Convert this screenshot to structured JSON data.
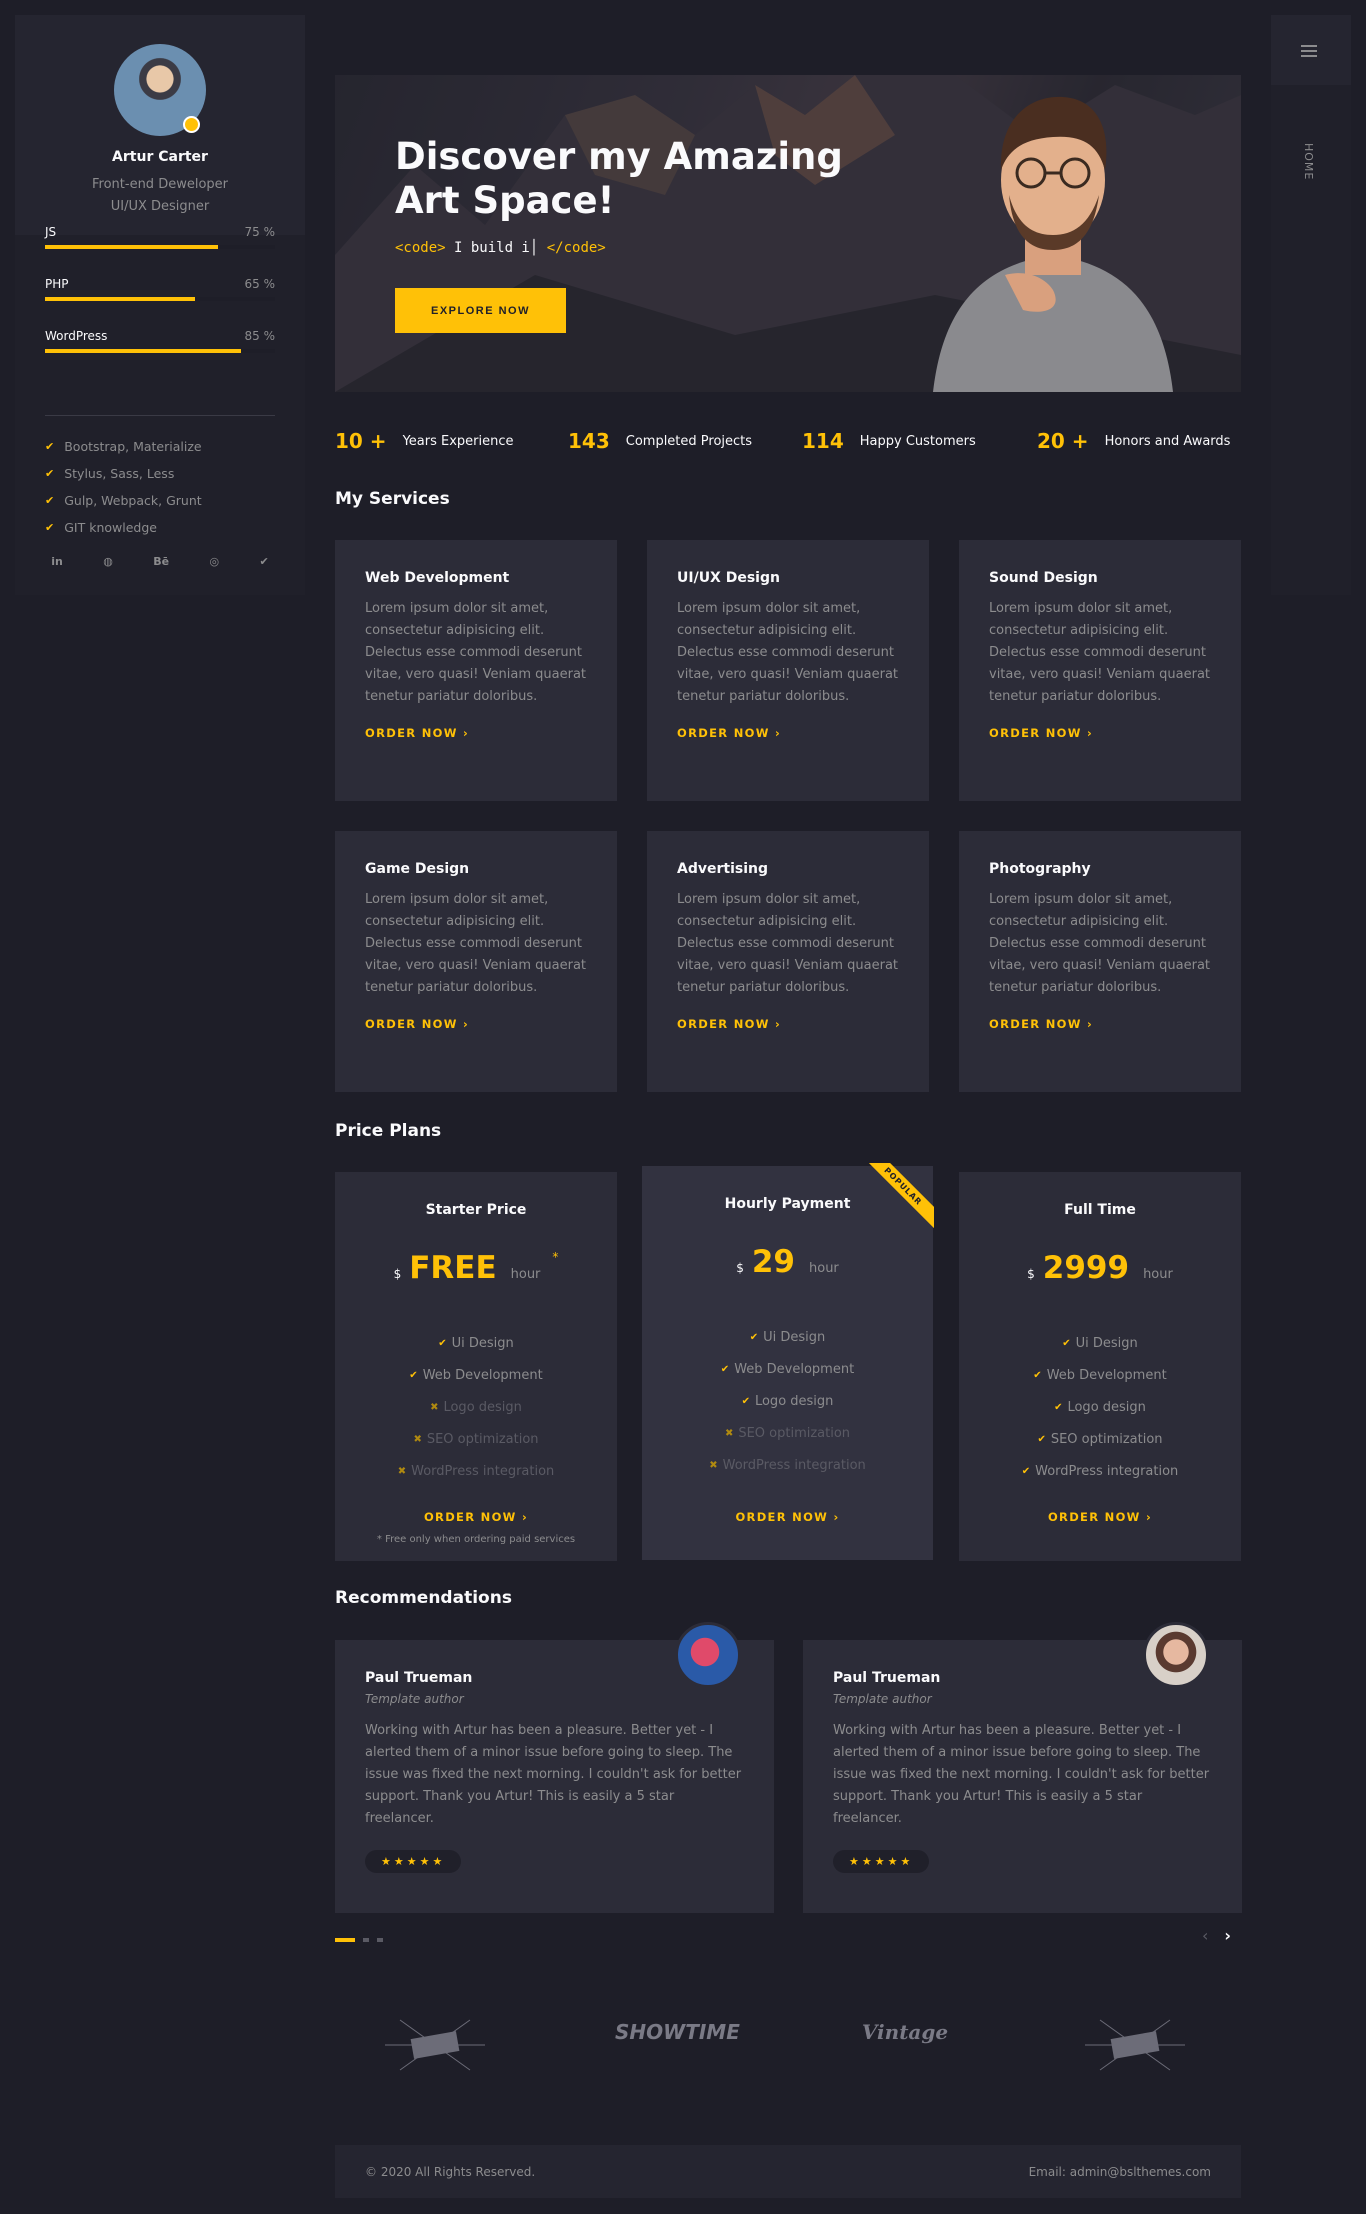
{
  "sidebar": {
    "name": "Artur Carter",
    "role_1": "Front-end Deweloper",
    "role_2": "UI/UX Designer",
    "skills": [
      {
        "label": "JS",
        "percent": "75 %",
        "value": 75
      },
      {
        "label": "PHP",
        "percent": "65 %",
        "value": 65
      },
      {
        "label": "WordPress",
        "percent": "85 %",
        "value": 85
      }
    ],
    "knowledge": [
      "Bootstrap, Materialize",
      "Stylus, Sass, Less",
      "Gulp, Webpack, Grunt",
      "GIT knowledge"
    ],
    "social": [
      "in",
      "◍",
      "Bē",
      "◎",
      "✔"
    ]
  },
  "rail": {
    "label": "HOME"
  },
  "banner": {
    "title": "Discover my Amazing Art Space!",
    "code_open": "<code>",
    "code_text": " I build i",
    "code_close": "</code>",
    "button": "EXPLORE NOW"
  },
  "counters": [
    {
      "num": "10 +",
      "label": "Years Experience"
    },
    {
      "num": "143",
      "label": "Completed Projects"
    },
    {
      "num": "114",
      "label": "Happy Customers"
    },
    {
      "num": "20 +",
      "label": "Honors and Awards"
    }
  ],
  "services": {
    "title": "My Services",
    "items": [
      {
        "title": "Web Development",
        "text": "Lorem ipsum dolor sit amet, consectetur adipisicing elit. Delectus esse commodi deserunt vitae, vero quasi! Veniam quaerat tenetur pariatur doloribus.",
        "order": "ORDER NOW"
      },
      {
        "title": "UI/UX Design",
        "text": "Lorem ipsum dolor sit amet, consectetur adipisicing elit. Delectus esse commodi deserunt vitae, vero quasi! Veniam quaerat tenetur pariatur doloribus.",
        "order": "ORDER NOW"
      },
      {
        "title": "Sound Design",
        "text": "Lorem ipsum dolor sit amet, consectetur adipisicing elit. Delectus esse commodi deserunt vitae, vero quasi! Veniam quaerat tenetur pariatur doloribus.",
        "order": "ORDER NOW"
      },
      {
        "title": "Game Design",
        "text": "Lorem ipsum dolor sit amet, consectetur adipisicing elit. Delectus esse commodi deserunt vitae, vero quasi! Veniam quaerat tenetur pariatur doloribus.",
        "order": "ORDER NOW"
      },
      {
        "title": "Advertising",
        "text": "Lorem ipsum dolor sit amet, consectetur adipisicing elit. Delectus esse commodi deserunt vitae, vero quasi! Veniam quaerat tenetur pariatur doloribus.",
        "order": "ORDER NOW"
      },
      {
        "title": "Photography",
        "text": "Lorem ipsum dolor sit amet, consectetur adipisicing elit. Delectus esse commodi deserunt vitae, vero quasi! Veniam quaerat tenetur pariatur doloribus.",
        "order": "ORDER NOW"
      }
    ]
  },
  "pricing": {
    "title": "Price Plans",
    "plans": [
      {
        "name": "Starter Price",
        "currency": "$",
        "amount": "FREE",
        "per": "hour",
        "asterisk": "*",
        "order": "ORDER NOW",
        "note": "* Free only when ordering paid services",
        "features": [
          [
            "Ui Design",
            true
          ],
          [
            "Web Development",
            true
          ],
          [
            "Logo design",
            false
          ],
          [
            "SEO optimization",
            false
          ],
          [
            "WordPress integration",
            false
          ]
        ]
      },
      {
        "name": "Hourly Payment",
        "currency": "$",
        "amount": "29",
        "per": "hour",
        "order": "ORDER NOW",
        "ribbon": "POPULAR",
        "features": [
          [
            "Ui Design",
            true
          ],
          [
            "Web Development",
            true
          ],
          [
            "Logo design",
            true
          ],
          [
            "SEO optimization",
            false
          ],
          [
            "WordPress integration",
            false
          ]
        ]
      },
      {
        "name": "Full Time",
        "currency": "$",
        "amount": "2999",
        "per": "hour",
        "order": "ORDER NOW",
        "features": [
          [
            "Ui Design",
            true
          ],
          [
            "Web Development",
            true
          ],
          [
            "Logo design",
            true
          ],
          [
            "SEO optimization",
            true
          ],
          [
            "WordPress integration",
            true
          ]
        ]
      }
    ]
  },
  "recommendations": {
    "title": "Recommendations",
    "items": [
      {
        "name": "Paul Trueman",
        "role": "Template author",
        "text": "Working with Artur has been a pleasure. Better yet - I alerted them of a minor issue before going to sleep. The issue was fixed the next morning. I couldn't ask for better support. Thank you Artur! This is easily a 5 star freelancer.",
        "stars": "★★★★★"
      },
      {
        "name": "Paul Trueman",
        "role": "Template author",
        "text": "Working with Artur has been a pleasure. Better yet - I alerted them of a minor issue before going to sleep. The issue was fixed the next morning. I couldn't ask for better support. Thank you Artur! This is easily a 5 star freelancer.",
        "stars": "★★★★★"
      }
    ]
  },
  "brands": [
    "SHOWTIME",
    "Vintage"
  ],
  "footer": {
    "copyright": "© 2020 All Rights Reserved.",
    "email": "Email: admin@bslthemes.com"
  },
  "colors": {
    "accent": "#ffc107",
    "bg": "#1e1e28",
    "card": "#2c2c38"
  }
}
